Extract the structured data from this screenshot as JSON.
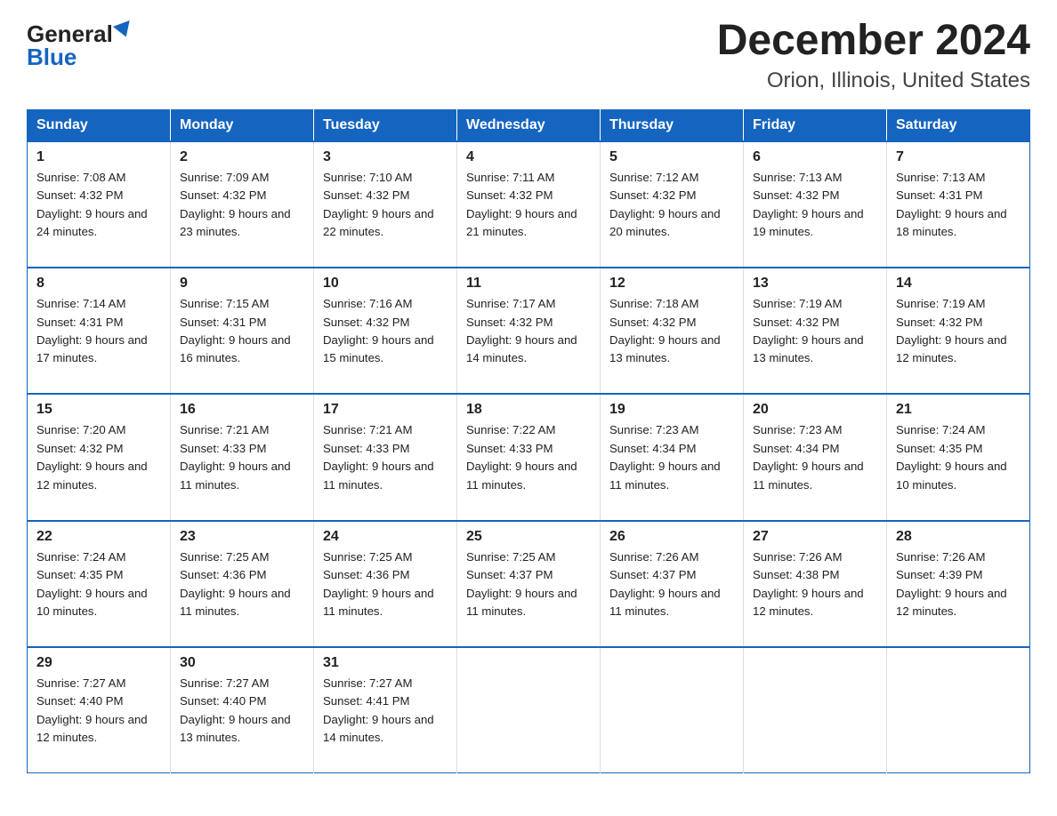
{
  "logo": {
    "general": "General",
    "blue": "Blue"
  },
  "title": "December 2024",
  "subtitle": "Orion, Illinois, United States",
  "days_of_week": [
    "Sunday",
    "Monday",
    "Tuesday",
    "Wednesday",
    "Thursday",
    "Friday",
    "Saturday"
  ],
  "weeks": [
    [
      {
        "day": "1",
        "sunrise": "7:08 AM",
        "sunset": "4:32 PM",
        "daylight": "9 hours and 24 minutes."
      },
      {
        "day": "2",
        "sunrise": "7:09 AM",
        "sunset": "4:32 PM",
        "daylight": "9 hours and 23 minutes."
      },
      {
        "day": "3",
        "sunrise": "7:10 AM",
        "sunset": "4:32 PM",
        "daylight": "9 hours and 22 minutes."
      },
      {
        "day": "4",
        "sunrise": "7:11 AM",
        "sunset": "4:32 PM",
        "daylight": "9 hours and 21 minutes."
      },
      {
        "day": "5",
        "sunrise": "7:12 AM",
        "sunset": "4:32 PM",
        "daylight": "9 hours and 20 minutes."
      },
      {
        "day": "6",
        "sunrise": "7:13 AM",
        "sunset": "4:32 PM",
        "daylight": "9 hours and 19 minutes."
      },
      {
        "day": "7",
        "sunrise": "7:13 AM",
        "sunset": "4:31 PM",
        "daylight": "9 hours and 18 minutes."
      }
    ],
    [
      {
        "day": "8",
        "sunrise": "7:14 AM",
        "sunset": "4:31 PM",
        "daylight": "9 hours and 17 minutes."
      },
      {
        "day": "9",
        "sunrise": "7:15 AM",
        "sunset": "4:31 PM",
        "daylight": "9 hours and 16 minutes."
      },
      {
        "day": "10",
        "sunrise": "7:16 AM",
        "sunset": "4:32 PM",
        "daylight": "9 hours and 15 minutes."
      },
      {
        "day": "11",
        "sunrise": "7:17 AM",
        "sunset": "4:32 PM",
        "daylight": "9 hours and 14 minutes."
      },
      {
        "day": "12",
        "sunrise": "7:18 AM",
        "sunset": "4:32 PM",
        "daylight": "9 hours and 13 minutes."
      },
      {
        "day": "13",
        "sunrise": "7:19 AM",
        "sunset": "4:32 PM",
        "daylight": "9 hours and 13 minutes."
      },
      {
        "day": "14",
        "sunrise": "7:19 AM",
        "sunset": "4:32 PM",
        "daylight": "9 hours and 12 minutes."
      }
    ],
    [
      {
        "day": "15",
        "sunrise": "7:20 AM",
        "sunset": "4:32 PM",
        "daylight": "9 hours and 12 minutes."
      },
      {
        "day": "16",
        "sunrise": "7:21 AM",
        "sunset": "4:33 PM",
        "daylight": "9 hours and 11 minutes."
      },
      {
        "day": "17",
        "sunrise": "7:21 AM",
        "sunset": "4:33 PM",
        "daylight": "9 hours and 11 minutes."
      },
      {
        "day": "18",
        "sunrise": "7:22 AM",
        "sunset": "4:33 PM",
        "daylight": "9 hours and 11 minutes."
      },
      {
        "day": "19",
        "sunrise": "7:23 AM",
        "sunset": "4:34 PM",
        "daylight": "9 hours and 11 minutes."
      },
      {
        "day": "20",
        "sunrise": "7:23 AM",
        "sunset": "4:34 PM",
        "daylight": "9 hours and 11 minutes."
      },
      {
        "day": "21",
        "sunrise": "7:24 AM",
        "sunset": "4:35 PM",
        "daylight": "9 hours and 10 minutes."
      }
    ],
    [
      {
        "day": "22",
        "sunrise": "7:24 AM",
        "sunset": "4:35 PM",
        "daylight": "9 hours and 10 minutes."
      },
      {
        "day": "23",
        "sunrise": "7:25 AM",
        "sunset": "4:36 PM",
        "daylight": "9 hours and 11 minutes."
      },
      {
        "day": "24",
        "sunrise": "7:25 AM",
        "sunset": "4:36 PM",
        "daylight": "9 hours and 11 minutes."
      },
      {
        "day": "25",
        "sunrise": "7:25 AM",
        "sunset": "4:37 PM",
        "daylight": "9 hours and 11 minutes."
      },
      {
        "day": "26",
        "sunrise": "7:26 AM",
        "sunset": "4:37 PM",
        "daylight": "9 hours and 11 minutes."
      },
      {
        "day": "27",
        "sunrise": "7:26 AM",
        "sunset": "4:38 PM",
        "daylight": "9 hours and 12 minutes."
      },
      {
        "day": "28",
        "sunrise": "7:26 AM",
        "sunset": "4:39 PM",
        "daylight": "9 hours and 12 minutes."
      }
    ],
    [
      {
        "day": "29",
        "sunrise": "7:27 AM",
        "sunset": "4:40 PM",
        "daylight": "9 hours and 12 minutes."
      },
      {
        "day": "30",
        "sunrise": "7:27 AM",
        "sunset": "4:40 PM",
        "daylight": "9 hours and 13 minutes."
      },
      {
        "day": "31",
        "sunrise": "7:27 AM",
        "sunset": "4:41 PM",
        "daylight": "9 hours and 14 minutes."
      },
      null,
      null,
      null,
      null
    ]
  ]
}
